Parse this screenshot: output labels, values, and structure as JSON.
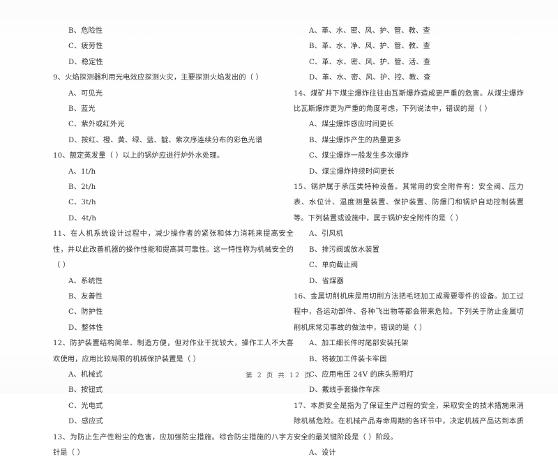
{
  "document": {
    "page_footer": "第 2 页  共 12 页",
    "text_color": "#333333",
    "background_color": "#FEFEFE"
  },
  "left_column": {
    "items": [
      {
        "type": "option",
        "text": "B、危险性"
      },
      {
        "type": "option",
        "text": "C、疲劳性"
      },
      {
        "type": "option",
        "text": "D、稳定性"
      },
      {
        "type": "question",
        "text": "9、火焰探测器利用光电效应探测火灾，主要探测火焰发出的（    ）"
      },
      {
        "type": "option",
        "text": "A、可见光"
      },
      {
        "type": "option",
        "text": "B、蓝光"
      },
      {
        "type": "option",
        "text": "C、紫外或红外光"
      },
      {
        "type": "option",
        "text": "D、按红、橙、黄、绿、蓝、靛、紫次序连续分布的彩色光谱"
      },
      {
        "type": "question",
        "text": "10、额定蒸发量（    ）以上的锅炉应进行炉外水处理。"
      },
      {
        "type": "option",
        "text": "A、1t/h"
      },
      {
        "type": "option",
        "text": "B、2t/h"
      },
      {
        "type": "option",
        "text": "C、3t/h"
      },
      {
        "type": "option",
        "text": "D、4t/h"
      },
      {
        "type": "question",
        "text": "11、在人机系统设计过程中，减少操作者的紧张和体力消耗来提高安全性，并以此改善机器的操作性能和提高其可靠性。这一特性称为机械安全的（    ）"
      },
      {
        "type": "option",
        "text": "A、系统性"
      },
      {
        "type": "option",
        "text": "B、友善性"
      },
      {
        "type": "option",
        "text": "C、防护性"
      },
      {
        "type": "option",
        "text": "D、整体性"
      },
      {
        "type": "question",
        "text": "12、防护装置结构简单、制造方便，但对作业干扰较大，操作工人不大喜欢使用，应用比较局限的机械保护装置是（    ）"
      },
      {
        "type": "option",
        "text": "A、机械式"
      },
      {
        "type": "option",
        "text": "B、按钮式"
      },
      {
        "type": "option",
        "text": "C、光电式"
      },
      {
        "type": "option",
        "text": "D、感应式"
      },
      {
        "type": "question",
        "text": "13、为防止生产性粉尘的危害，应加强防尘措施。综合防尘措施的八字方针是（    ）"
      }
    ]
  },
  "right_column": {
    "items": [
      {
        "type": "option",
        "text": "A、革、水、密、风、护、管、教、查"
      },
      {
        "type": "option",
        "text": "B、革、水、净、风、护、管、教、查"
      },
      {
        "type": "option",
        "text": "C、革、水、密、风、护、管、活、查"
      },
      {
        "type": "option",
        "text": "D、革、水、密、风、护、控、教、查"
      },
      {
        "type": "question",
        "text": "14、煤矿井下煤尘爆炸往往由瓦斯爆炸造成更严重的危害。从煤尘爆炸比瓦斯爆炸更为严重的角度考虑，下列说法中，错误的是（    ）"
      },
      {
        "type": "option",
        "text": "A、煤尘爆炸感应时间更长"
      },
      {
        "type": "option",
        "text": "B、煤尘爆炸产生的热量更多"
      },
      {
        "type": "option",
        "text": "C、煤尘爆炸一般发生多次爆炸"
      },
      {
        "type": "option",
        "text": "D、煤尘爆炸持续时间更长"
      },
      {
        "type": "question",
        "text": "15、锅炉属于承压类特种设备。其常用的安全附件有：安全阀、压力表、水位计、温度测量装置、保护装置、防爆门和锅炉自动控制装置等。下列装置或设施中，属于锅炉安全附件的是（    ）"
      },
      {
        "type": "option",
        "text": "A、引风机"
      },
      {
        "type": "option",
        "text": "B、排污阀或放水装置"
      },
      {
        "type": "option",
        "text": "C、单向截止阀"
      },
      {
        "type": "option",
        "text": "D、省煤器"
      },
      {
        "type": "question",
        "text": "16、金属切削机床是用切削方法把毛坯加工成需要零件的设备。加工过程中，各运动部件、各种飞出物等都会带来危险。下列关于防止金属切削机床常见事故的做法中，错误的是（    ）"
      },
      {
        "type": "option",
        "text": "A、加工细长件时尾部安装托架"
      },
      {
        "type": "option",
        "text": "B、将被加工件装卡牢固"
      },
      {
        "type": "option",
        "text": "C、应用电压 24V 的床头照明灯"
      },
      {
        "type": "option",
        "text": "D、戴线手套操作车床"
      },
      {
        "type": "question",
        "text": "17、本质安全是指为了保证生产过程的安全，采取安全的技术措施来消除机械危险。在机械产品寿命周期的各环节中，决定机械产品达到本质安全的最关键阶段是（    ）阶段。"
      },
      {
        "type": "option",
        "text": "A、设计"
      }
    ]
  }
}
